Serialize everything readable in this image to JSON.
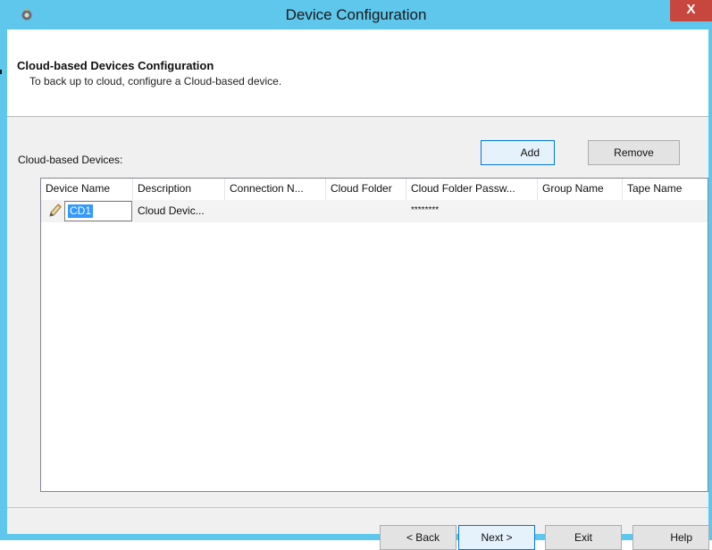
{
  "window": {
    "title": "Device Configuration",
    "close_label": "X",
    "app_icon": "app-gear-icon"
  },
  "header": {
    "title": "Cloud-based Devices Configuration",
    "subtitle": "To back up to cloud, configure a Cloud-based device."
  },
  "devices": {
    "label": "Cloud-based Devices:",
    "add_label": "Add",
    "remove_label": "Remove",
    "columns": [
      "Device Name",
      "Description",
      "Connection N...",
      "Cloud Folder",
      "Cloud Folder Passw...",
      "Group Name",
      "Tape Name"
    ],
    "rows": [
      {
        "icon": "pencil-icon",
        "device_name": "CD1",
        "description": "Cloud Devic...",
        "connection_name": "",
        "cloud_folder": "",
        "cloud_folder_password": "********",
        "group_name": "",
        "tape_name": ""
      }
    ]
  },
  "footer": {
    "back_label": "< Back",
    "next_label": "Next >",
    "exit_label": "Exit",
    "help_label": "Help"
  },
  "colors": {
    "title_bar": "#5fc6ec",
    "close_button": "#c7473e",
    "selection": "#3399ff",
    "focus_border": "#0078d7"
  }
}
